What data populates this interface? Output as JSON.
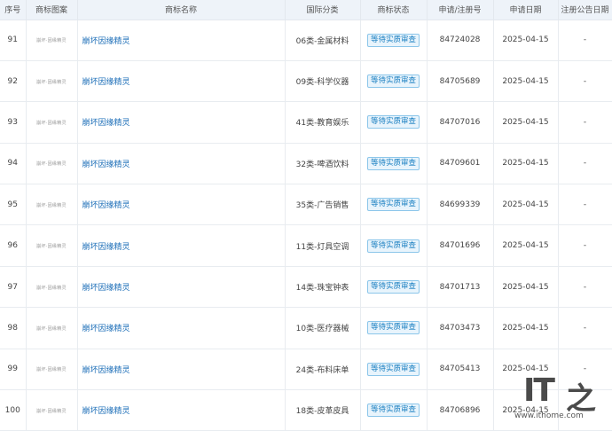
{
  "headers": [
    "序号",
    "商标图案",
    "商标名称",
    "国际分类",
    "商标状态",
    "申请/注册号",
    "申请日期",
    "注册公告日期"
  ],
  "rows": [
    {
      "no": "91",
      "image_text": "崩坏·因缘精灵",
      "name": "崩坏因缘精灵",
      "class": "06类-金属材料",
      "status": "等待实质审查",
      "reg": "84724028",
      "date": "2025-04-15",
      "pub": "-"
    },
    {
      "no": "92",
      "image_text": "崩坏·因缘精灵",
      "name": "崩坏因缘精灵",
      "class": "09类-科学仪器",
      "status": "等待实质审查",
      "reg": "84705689",
      "date": "2025-04-15",
      "pub": "-"
    },
    {
      "no": "93",
      "image_text": "崩坏·因缘精灵",
      "name": "崩坏因缘精灵",
      "class": "41类-教育娱乐",
      "status": "等待实质审查",
      "reg": "84707016",
      "date": "2025-04-15",
      "pub": "-"
    },
    {
      "no": "94",
      "image_text": "崩坏·因缘精灵",
      "name": "崩坏因缘精灵",
      "class": "32类-啤酒饮料",
      "status": "等待实质审查",
      "reg": "84709601",
      "date": "2025-04-15",
      "pub": "-"
    },
    {
      "no": "95",
      "image_text": "崩坏·因缘精灵",
      "name": "崩坏因缘精灵",
      "class": "35类-广告销售",
      "status": "等待实质审查",
      "reg": "84699339",
      "date": "2025-04-15",
      "pub": "-"
    },
    {
      "no": "96",
      "image_text": "崩坏·因缘精灵",
      "name": "崩坏因缘精灵",
      "class": "11类-灯具空调",
      "status": "等待实质审查",
      "reg": "84701696",
      "date": "2025-04-15",
      "pub": "-"
    },
    {
      "no": "97",
      "image_text": "崩坏·因缘精灵",
      "name": "崩坏因缘精灵",
      "class": "14类-珠宝钟表",
      "status": "等待实质审查",
      "reg": "84701713",
      "date": "2025-04-15",
      "pub": "-"
    },
    {
      "no": "98",
      "image_text": "崩坏·因缘精灵",
      "name": "崩坏因缘精灵",
      "class": "10类-医疗器械",
      "status": "等待实质审查",
      "reg": "84703473",
      "date": "2025-04-15",
      "pub": "-"
    },
    {
      "no": "99",
      "image_text": "崩坏·因缘精灵",
      "name": "崩坏因缘精灵",
      "class": "24类-布料床单",
      "status": "等待实质审查",
      "reg": "84705413",
      "date": "2025-04-15",
      "pub": "-"
    },
    {
      "no": "100",
      "image_text": "崩坏·因缘精灵",
      "name": "崩坏因缘精灵",
      "class": "18类-皮革皮具",
      "status": "等待实质审查",
      "reg": "84706896",
      "date": "2025-04-15",
      "pub": "-"
    }
  ],
  "watermark": {
    "logo_text": "IT",
    "logo_char": "之",
    "url": "www.ithome.com"
  },
  "colors": {
    "header_bg": "#eef3f9",
    "link": "#1e6fb8",
    "badge_text": "#1a7fc1",
    "badge_bg": "#e8f4fc",
    "badge_border": "#8cc6ea"
  }
}
